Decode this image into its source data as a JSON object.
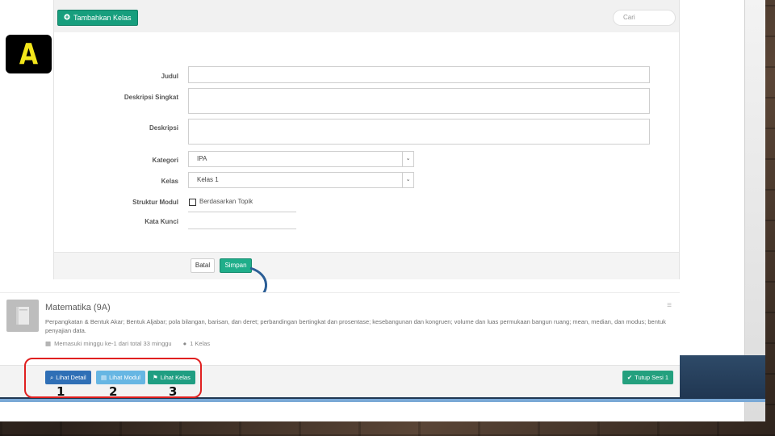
{
  "topbar": {
    "add_class_label": "Tambahkan Kelas",
    "search_placeholder": "Cari"
  },
  "annotation_letter": "A",
  "form": {
    "labels": {
      "title": "Judul",
      "short_description": "Deskripsi Singkat",
      "description": "Deskripsi",
      "category": "Kategori",
      "class": "Kelas",
      "module_structure": "Struktur Modul",
      "keywords": "Kata Kunci"
    },
    "category_value": "IPA",
    "class_value": "Kelas 1",
    "checkbox_label": "Berdasarkan Topik",
    "cancel_label": "Batal",
    "save_label": "Simpan"
  },
  "card": {
    "title": "Matematika (9A)",
    "description": "Perpangkatan & Bentuk Akar; Bentuk Aljabar; pola bilangan, barisan, dan deret; perbandingan bertingkat dan prosentase; kesebangunan dan kongruen; volume dan luas permukaan bangun ruang; mean, median, dan modus; bentuk penyajian data.",
    "meta_weeks": "Memasuki minggu ke-1 dari total 33 minggu",
    "meta_class": "1 Kelas",
    "buttons": {
      "detail": "Lihat Detail",
      "module": "Lihat Modul",
      "class": "Lihat Kelas",
      "close_semester": "Tutup Sesi 1"
    }
  },
  "numbers": [
    "1",
    "2",
    "3"
  ],
  "colors": {
    "primary_teal": "#1fae8a",
    "primary_blue": "#2f6fb6",
    "light_blue": "#66b6e3",
    "highlight_red": "#e02020",
    "annotation_yellow": "#f3e61b"
  },
  "icons": {
    "add": "plus-circle-icon",
    "detail": "search-icon",
    "module": "book-icon",
    "class": "flag-icon",
    "close": "check-circle-icon",
    "menu": "hamburger-icon",
    "calendar": "calendar-icon",
    "user": "user-icon",
    "book_thumb": "book-thumb-icon"
  }
}
